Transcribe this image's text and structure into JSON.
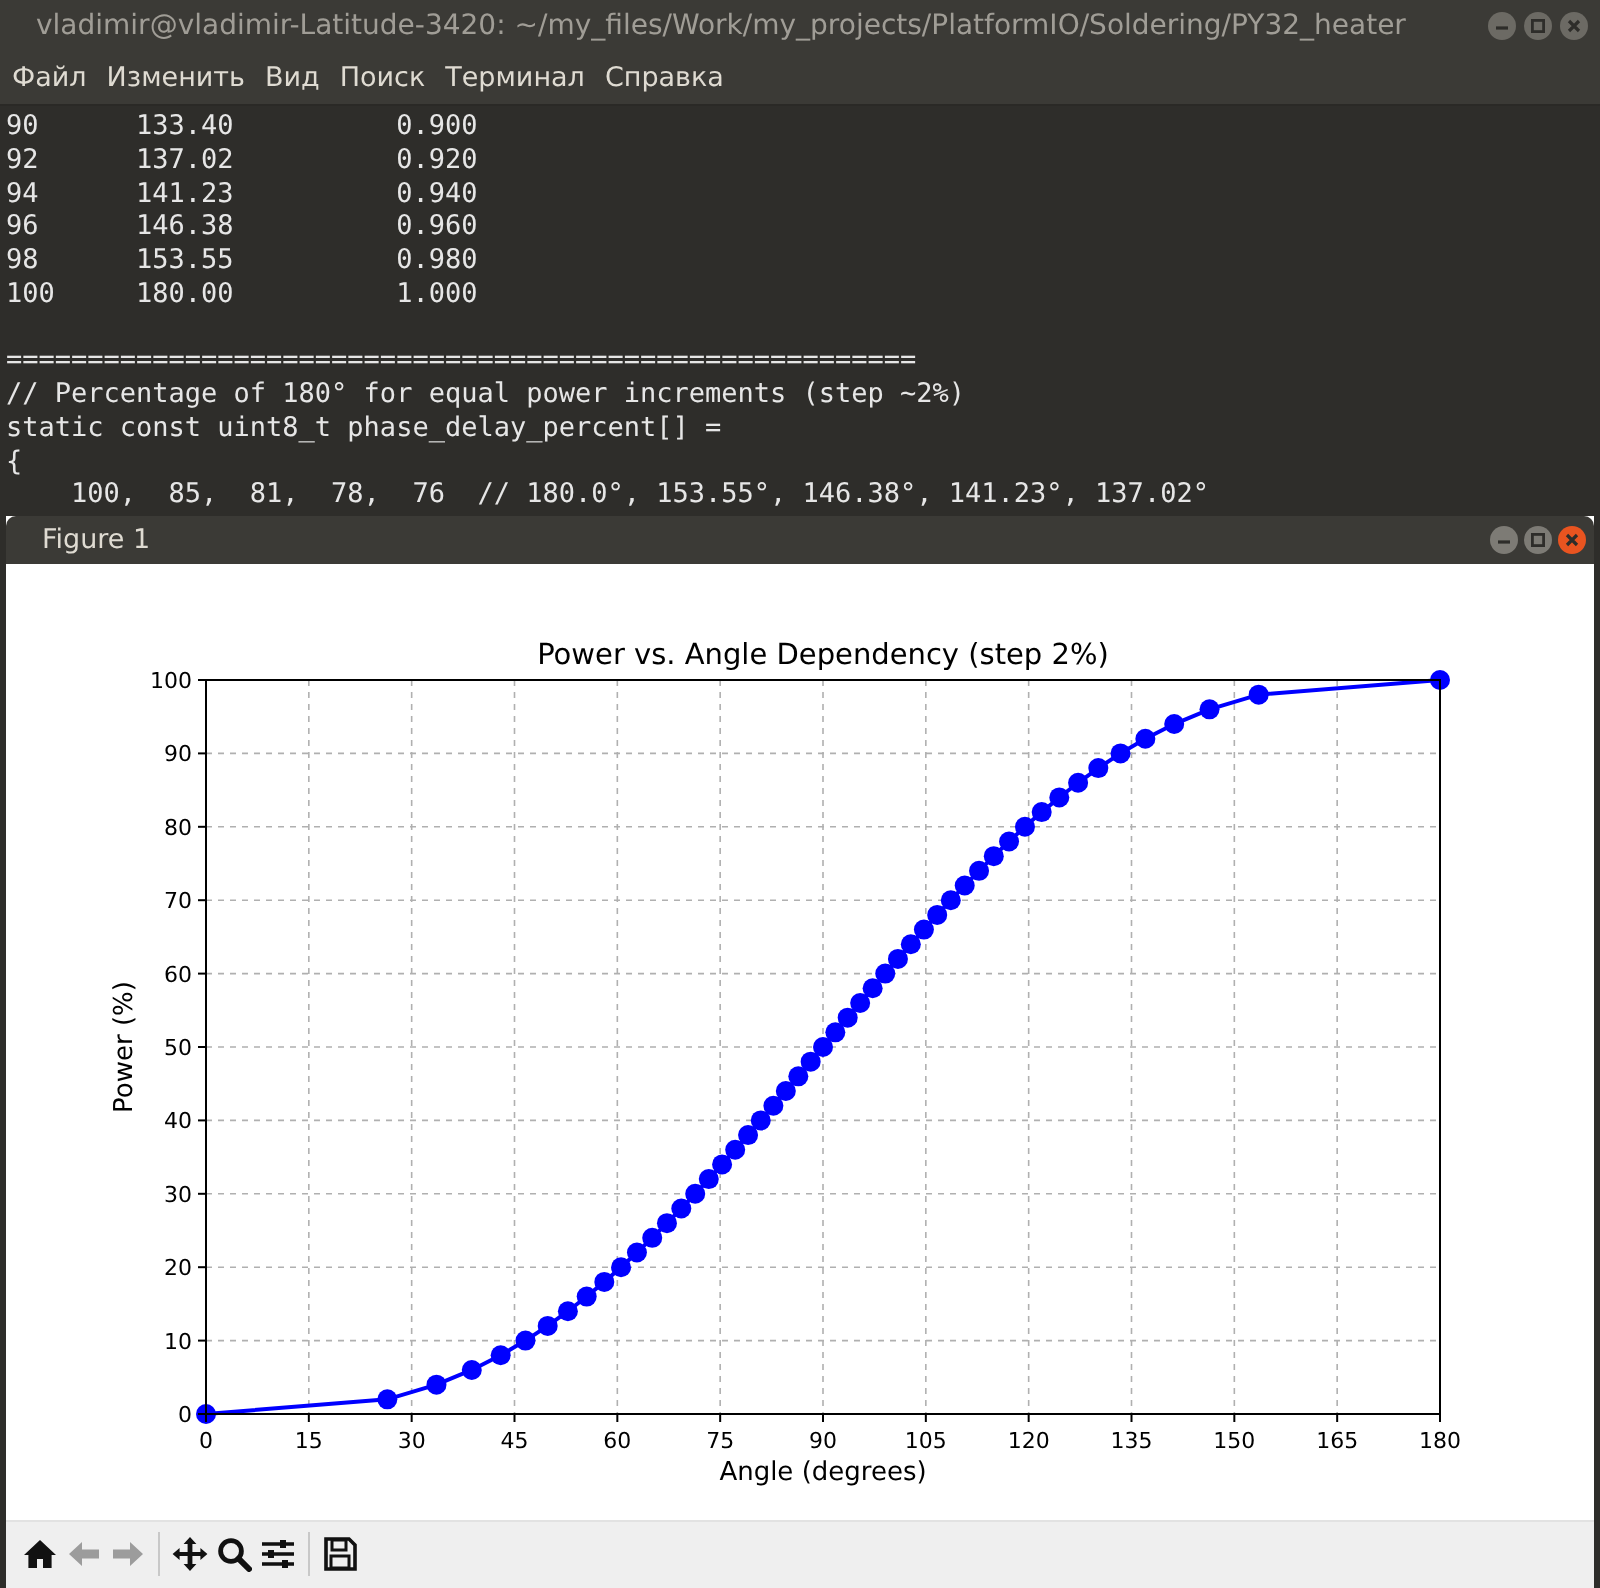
{
  "terminal": {
    "title": "vladimir@vladimir-Latitude-3420: ~/my_files/Work/my_projects/PlatformIO/Soldering/PY32_heater",
    "menu": [
      "Файл",
      "Изменить",
      "Вид",
      "Поиск",
      "Терминал",
      "Справка"
    ],
    "table_rows": [
      "90      133.40          0.900",
      "92      137.02          0.920",
      "94      141.23          0.940",
      "96      146.38          0.960",
      "98      153.55          0.980",
      "100     180.00          1.000"
    ],
    "code_lines": [
      "========================================================",
      "// Percentage of 180° for equal power increments (step ~2%)",
      "static const uint8_t phase_delay_percent[] =",
      "{",
      "    100,  85,  81,  78,  76  // 180.0°, 153.55°, 146.38°, 141.23°, 137.02°"
    ]
  },
  "figure": {
    "title": "Figure 1",
    "chart_data": {
      "type": "line",
      "title": "Power vs. Angle Dependency (step 2%)",
      "xlabel": "Angle (degrees)",
      "ylabel": "Power (%)",
      "x": [
        0,
        26.45,
        33.62,
        38.77,
        42.98,
        46.6,
        49.84,
        52.79,
        55.53,
        58.1,
        60.54,
        62.86,
        65.09,
        67.24,
        69.33,
        71.36,
        73.34,
        75.28,
        77.19,
        79.07,
        80.92,
        82.76,
        84.58,
        86.4,
        88.2,
        90.0,
        91.8,
        93.6,
        95.42,
        97.24,
        99.08,
        100.93,
        102.81,
        104.72,
        106.66,
        108.64,
        110.67,
        112.76,
        114.91,
        117.14,
        119.46,
        121.9,
        124.47,
        127.21,
        130.16,
        133.4,
        137.02,
        141.23,
        146.38,
        153.55,
        180
      ],
      "grid": true,
      "series": [
        {
          "color": "#0000ff",
          "marker": "o",
          "values": [
            0,
            2,
            4,
            6,
            8,
            10,
            12,
            14,
            16,
            18,
            20,
            22,
            24,
            26,
            28,
            30,
            32,
            34,
            36,
            38,
            40,
            42,
            44,
            46,
            48,
            50,
            52,
            54,
            56,
            58,
            60,
            62,
            64,
            66,
            68,
            70,
            72,
            74,
            76,
            78,
            80,
            82,
            84,
            86,
            88,
            90,
            92,
            94,
            96,
            98,
            100
          ]
        }
      ],
      "xlim": [
        0,
        180
      ],
      "ylim": [
        0,
        100
      ],
      "xticks": [
        0,
        15,
        30,
        45,
        60,
        75,
        90,
        105,
        120,
        135,
        150,
        165,
        180
      ],
      "yticks": [
        0,
        10,
        20,
        30,
        40,
        50,
        60,
        70,
        80,
        90,
        100
      ]
    },
    "toolbar": [
      {
        "kind": "home",
        "disabled": false
      },
      {
        "kind": "back",
        "disabled": true
      },
      {
        "kind": "forward",
        "disabled": true
      },
      {
        "kind": "separator"
      },
      {
        "kind": "move",
        "disabled": false
      },
      {
        "kind": "zoom",
        "disabled": false
      },
      {
        "kind": "configure",
        "disabled": false
      },
      {
        "kind": "separator"
      },
      {
        "kind": "save",
        "disabled": false
      }
    ]
  }
}
